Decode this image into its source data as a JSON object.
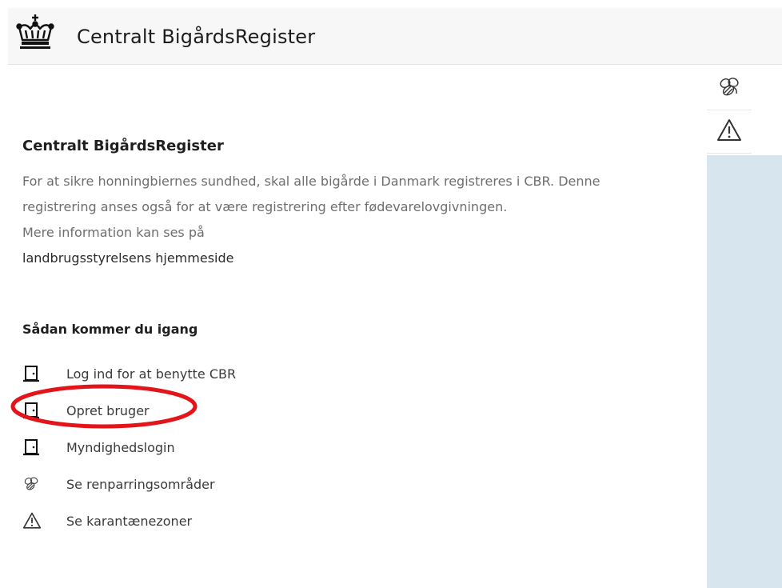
{
  "header": {
    "title": "Centralt BigårdsRegister",
    "logo_icon": "crown-icon"
  },
  "side_panel": {
    "buttons": [
      {
        "icon": "bee-icon"
      },
      {
        "icon": "warning-icon"
      }
    ],
    "map_color": "#d7e6ee"
  },
  "intro": {
    "title": "Centralt BigårdsRegister",
    "line1": "For at sikre honningbiernes sundhed, skal alle bigårde i Danmark registreres i CBR. Denne",
    "line2": "registrering anses også for at være registrering efter fødevarelovgivningen.",
    "line3": "Mere information kan ses på",
    "link": "landbrugsstyrelsens hjemmeside"
  },
  "getting_started": {
    "title": "Sådan kommer du igang",
    "items": [
      {
        "label": "Log ind for at benytte CBR",
        "icon": "door-icon"
      },
      {
        "label": "Opret bruger",
        "icon": "door-icon"
      },
      {
        "label": "Myndighedslogin",
        "icon": "door-icon"
      },
      {
        "label": "Se renparringsområder",
        "icon": "bee-icon"
      },
      {
        "label": "Se karantænezoner",
        "icon": "warning-icon"
      }
    ]
  },
  "annotation": {
    "color": "#e3151b"
  }
}
